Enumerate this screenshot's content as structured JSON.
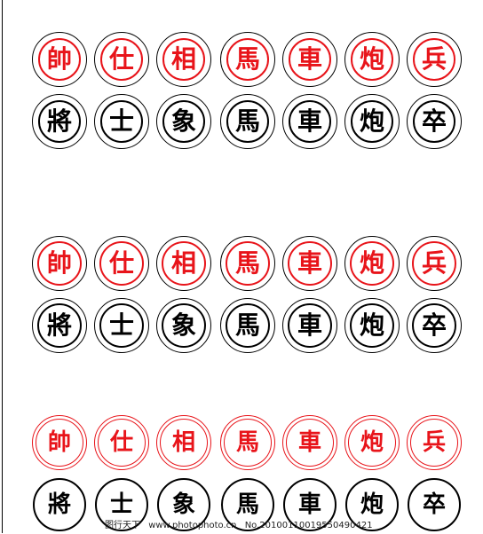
{
  "pieces": {
    "red": [
      "帥",
      "仕",
      "相",
      "馬",
      "車",
      "炮",
      "兵"
    ],
    "black": [
      "將",
      "士",
      "象",
      "馬",
      "車",
      "炮",
      "卒"
    ]
  },
  "colors": {
    "red": "#e8141a",
    "black": "#000000"
  },
  "footer": {
    "site": "图行天下",
    "url": "www.photophoto.cn",
    "number": "No.20100110019550490421"
  }
}
